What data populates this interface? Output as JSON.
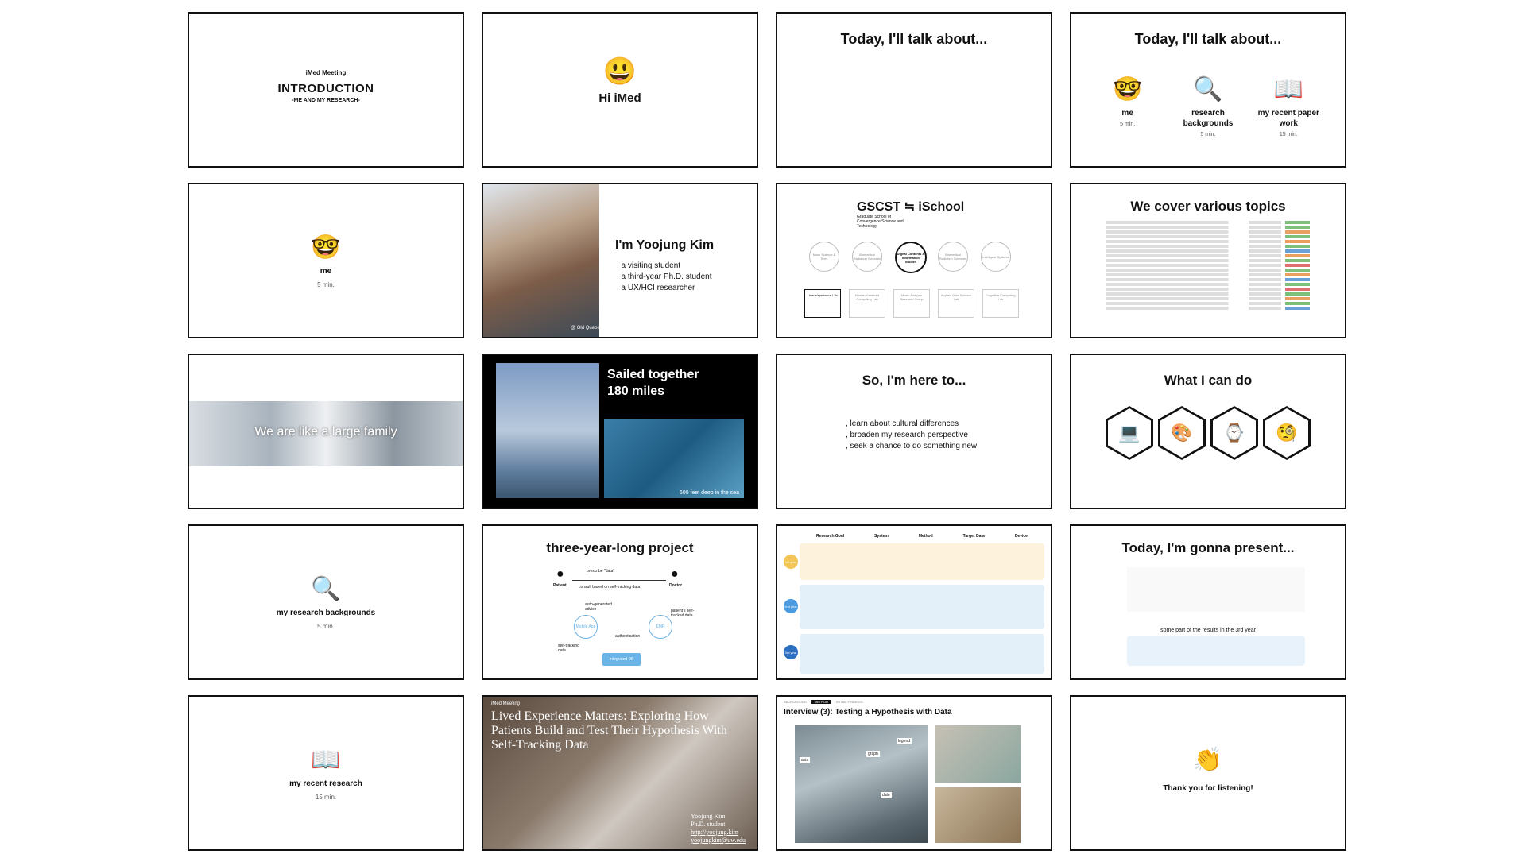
{
  "slides": {
    "s1": {
      "meta": "iMed Meeting",
      "title": "INTRODUCTION",
      "subtitle": "-ME AND MY RESEARCH-"
    },
    "s2": {
      "emoji": "😃",
      "text": "Hi iMed"
    },
    "s3": {
      "title": "Today, I'll talk about..."
    },
    "s4": {
      "title": "Today, I'll talk about...",
      "items": [
        {
          "icon": "🤓",
          "label": "me",
          "duration": "5 min."
        },
        {
          "icon": "🔍",
          "label": "research backgrounds",
          "duration": "5 min."
        },
        {
          "icon": "📖",
          "label": "my recent paper work",
          "duration": "15 min."
        }
      ]
    },
    "s5": {
      "icon": "🤓",
      "label": "me",
      "duration": "5 min."
    },
    "s6": {
      "name": "I'm Yoojung Kim",
      "lines": [
        ", a visiting student",
        ", a third-year Ph.D. student",
        ", a UX/HCI researcher"
      ],
      "caption": "@ Old Quebec City"
    },
    "s7": {
      "title": "GSCST ≒ iSchool",
      "subtitle": "Graduate School of Convergence Science and Technology",
      "nodes": [
        "Nano Science & Tech.",
        "Biomedical Radiation Sciences",
        "Digital Contents & Information Studies",
        "Biomedical Radiation Sciences",
        "Intelligent Systems"
      ],
      "labs": [
        "User eXperience Lab",
        "Human Centered Computing Lab",
        "Music Analysis Research Group",
        "Applied Data Science Lab",
        "Cognitive Computing Lab"
      ]
    },
    "s8": {
      "title": "We cover various topics"
    },
    "s9": {
      "caption": "We are like a large family"
    },
    "s10": {
      "title_line1": "Sailed together",
      "title_line2": "180 miles",
      "caption": "600 feet deep in the sea"
    },
    "s11": {
      "title": "So, I'm here to...",
      "lines": [
        ", learn about cultural differences",
        ", broaden my research perspective",
        ", seek a chance to do something new"
      ]
    },
    "s12": {
      "title": "What I can do",
      "icons": [
        "💻",
        "🎨",
        "⌚",
        "🧐"
      ]
    },
    "s13": {
      "icon": "🔍",
      "label": "my research backgrounds",
      "duration": "5 min."
    },
    "s14": {
      "title": "three-year-long project",
      "patient": "Patient",
      "doctor": "Doctor",
      "prescribe": "prescribe \"data\"",
      "consult": "consult based on self-tracking data",
      "auto": "auto-generated advice",
      "tracked": "patient's self-tracked data",
      "mobile": "Mobile App",
      "emr": "EMR",
      "selftrack": "self-tracking data",
      "auth": "authentication",
      "db": "Integrated DB"
    },
    "s15": {
      "headers": [
        "Research Goal",
        "System",
        "Method",
        "Target Data",
        "Device"
      ],
      "years": [
        "1st year",
        "2nd year",
        "3rd year"
      ]
    },
    "s16": {
      "title": "Today, I'm gonna present...",
      "caption": "some part of the results in the 3rd year"
    },
    "s17": {
      "icon": "📖",
      "label": "my recent research",
      "duration": "15 min."
    },
    "s18": {
      "meta": "iMed Meeting",
      "title": "Lived Experience Matters: Exploring How Patients Build and Test Their Hypothesis With Self-Tracking Data",
      "author": "Yoojung Kim",
      "role": "Ph.D. student",
      "link": "http://yoojung.kim",
      "email": "yoojungkim@uw.edu"
    },
    "s19": {
      "tabs": [
        "BACKGROUND",
        "METHOD",
        "INITIAL FINDINGS"
      ],
      "title": "Interview (3): Testing a Hypothesis with Data",
      "tags": [
        "axis",
        "graph",
        "legend",
        "date"
      ]
    },
    "s20": {
      "icon": "👏",
      "text": "Thank you for listening!"
    }
  }
}
